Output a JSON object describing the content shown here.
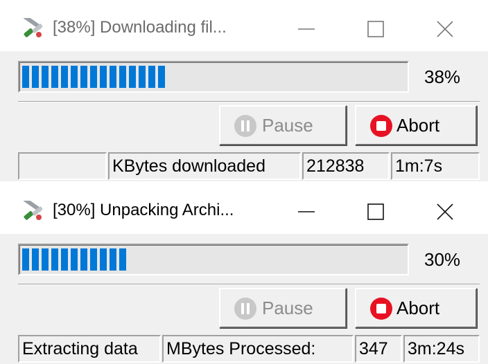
{
  "windows": [
    {
      "title": "[38%] Downloading fil...",
      "progress_fraction": 0.38,
      "percent_label": "38%",
      "pause_label": "Pause",
      "abort_label": "Abort",
      "status": {
        "cell1": "",
        "cell2": "KBytes downloaded",
        "cell3": "212838",
        "cell4": "1m:7s"
      }
    },
    {
      "title": "[30%] Unpacking Archi...",
      "progress_fraction": 0.3,
      "percent_label": "30%",
      "pause_label": "Pause",
      "abort_label": "Abort",
      "status": {
        "cell1": "Extracting data",
        "cell2": "MBytes Processed:",
        "cell3": "347",
        "cell4": "3m:24s"
      }
    }
  ],
  "colors": {
    "progress_fill": "#0078d7",
    "abort_icon": "#e81123",
    "disabled_text": "#8c8c8c"
  },
  "icons": {
    "app": "tools-icon",
    "minimize": "minimize-icon",
    "maximize": "maximize-icon",
    "close": "close-icon",
    "pause": "pause-icon",
    "abort": "stop-icon"
  }
}
